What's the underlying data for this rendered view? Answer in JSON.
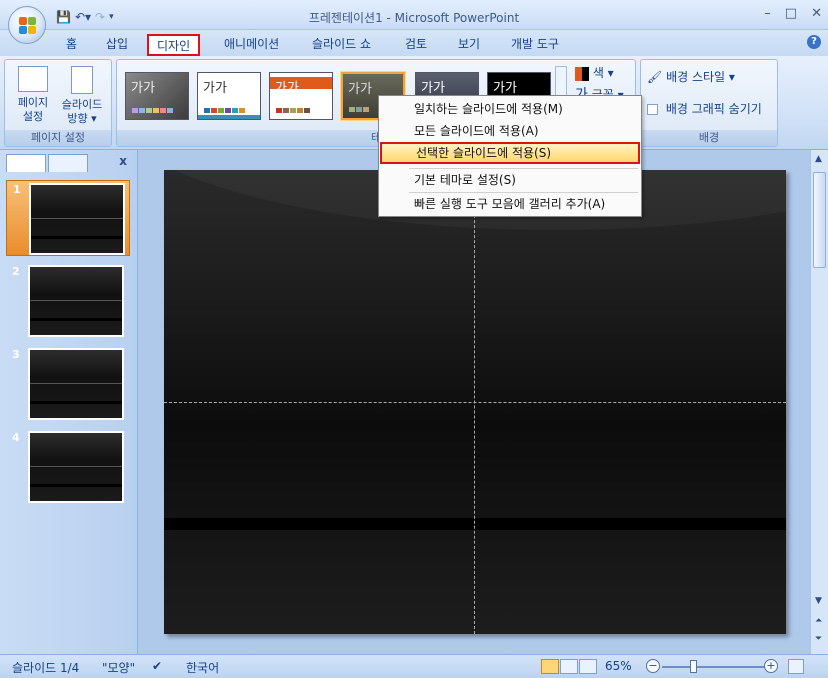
{
  "window": {
    "title": "프레젠테이션1 - Microsoft PowerPoint",
    "controls": [
      "–",
      "□",
      "✕"
    ]
  },
  "tabs": [
    "홈",
    "삽입",
    "디자인",
    "애니메이션",
    "슬라이드 쇼",
    "검토",
    "보기",
    "개발 도구"
  ],
  "active_tab": "디자인",
  "ribbon": {
    "page_setup_group": {
      "label": "페이지 설정",
      "page_setup_line1": "페이지",
      "page_setup_line2": "설정",
      "orientation_line1": "슬라이드",
      "orientation_line2": "방향 ▾"
    },
    "themes_group": {
      "label_visible": "테",
      "theme_sample_text": "가가",
      "colors_label": "색 ▾",
      "fonts_label": "글꼴 ▾"
    },
    "background_group": {
      "label": "배경",
      "background_styles": "배경 스타일 ▾",
      "hide_background_graphics": "배경 그래픽 숨기기"
    }
  },
  "context_menu": {
    "items": [
      "일치하는 슬라이드에 적용(M)",
      "모든 슬라이드에 적용(A)",
      "선택한 슬라이드에 적용(S)",
      "기본 테마로 설정(S)",
      "빠른 실행 도구 모음에 갤러리 추가(A)"
    ],
    "highlighted_index": 2
  },
  "slides_panel": {
    "slide_numbers": [
      "1",
      "2",
      "3",
      "4"
    ],
    "selected": "1",
    "close_label": "x"
  },
  "status_bar": {
    "slide_position": "슬라이드 1/4",
    "theme_name": "\"모양\"",
    "language": "한국어",
    "zoom": "65%"
  },
  "colors": {
    "highlight_border": "#d8141a",
    "ribbon_text": "#15428b",
    "menu_highlight": "#ffd76b"
  }
}
